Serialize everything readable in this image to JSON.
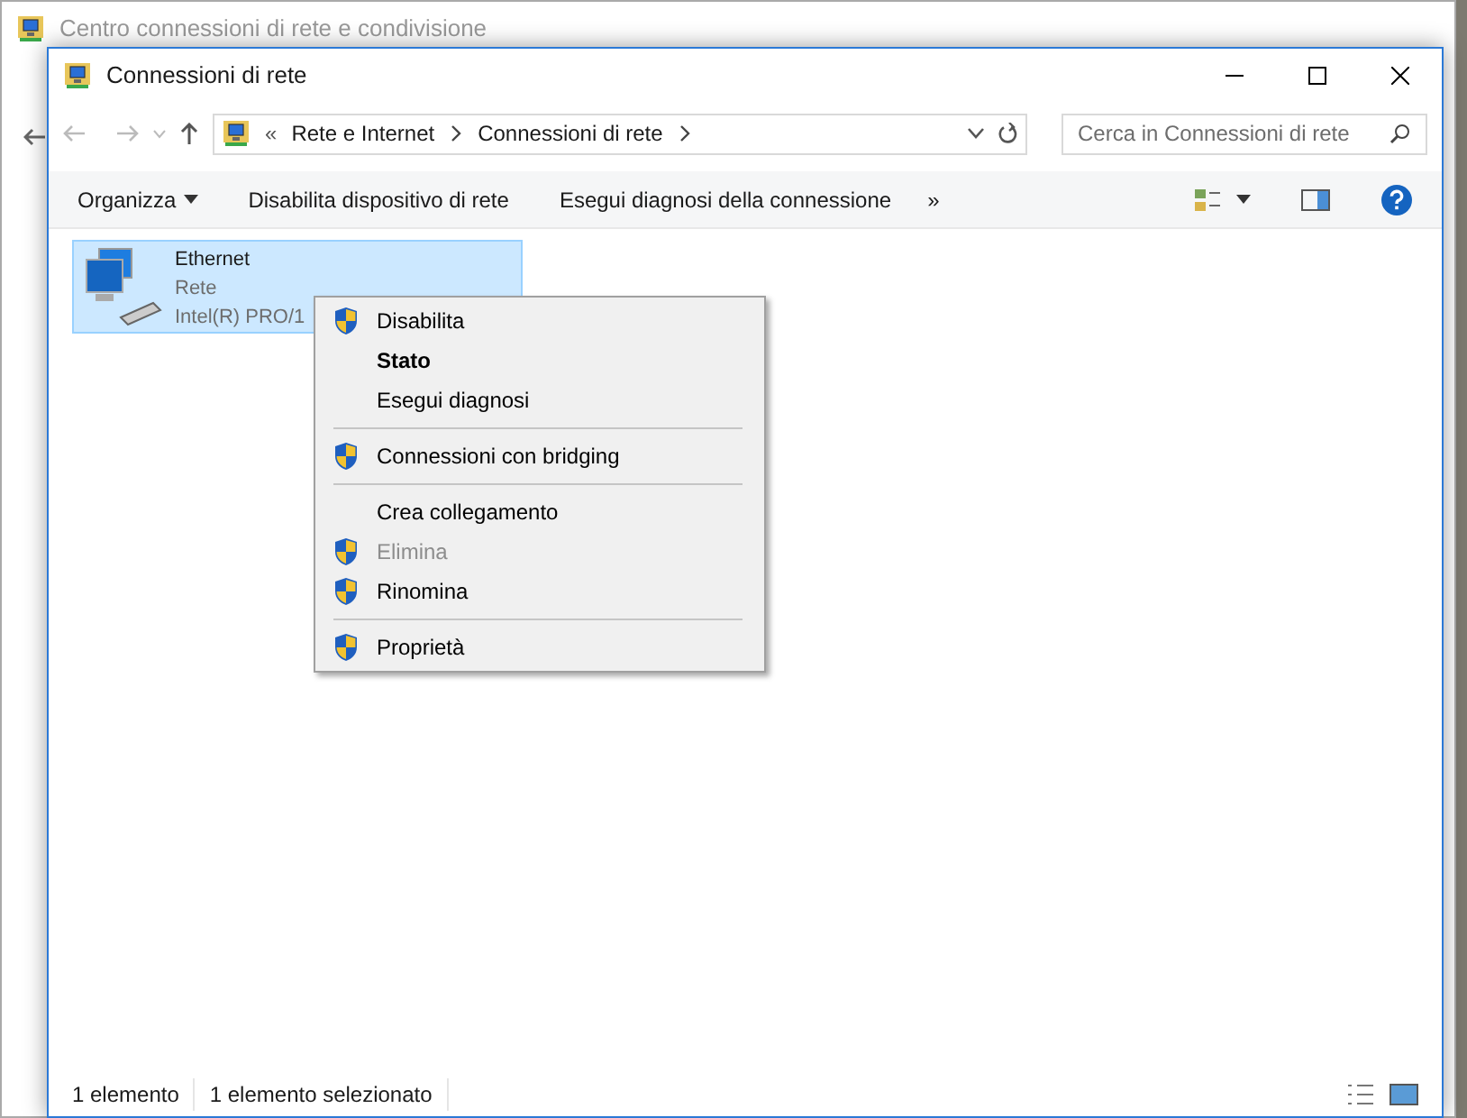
{
  "background_window": {
    "title": "Centro connessioni di rete e condivisione"
  },
  "window": {
    "title": "Connessioni di rete"
  },
  "address_bar": {
    "overflow": "«",
    "crumbs": [
      "Rete e Internet",
      "Connessioni di rete"
    ]
  },
  "search": {
    "placeholder": "Cerca in Connessioni di rete"
  },
  "toolbar": {
    "organize": "Organizza",
    "buttons": [
      "Disabilita dispositivo di rete",
      "Esegui diagnosi della connessione"
    ],
    "more": "»"
  },
  "items": [
    {
      "name": "Ethernet",
      "status": "Rete",
      "device": "Intel(R) PRO/1",
      "selected": true
    }
  ],
  "context_menu": [
    {
      "kind": "item",
      "label": "Disabilita",
      "shield": true,
      "bold": false,
      "disabled": false
    },
    {
      "kind": "item",
      "label": "Stato",
      "shield": false,
      "bold": true,
      "disabled": false
    },
    {
      "kind": "item",
      "label": "Esegui diagnosi",
      "shield": false,
      "bold": false,
      "disabled": false
    },
    {
      "kind": "separator"
    },
    {
      "kind": "item",
      "label": "Connessioni con bridging",
      "shield": true,
      "bold": false,
      "disabled": false
    },
    {
      "kind": "separator"
    },
    {
      "kind": "item",
      "label": "Crea collegamento",
      "shield": false,
      "bold": false,
      "disabled": false
    },
    {
      "kind": "item",
      "label": "Elimina",
      "shield": true,
      "bold": false,
      "disabled": true
    },
    {
      "kind": "item",
      "label": "Rinomina",
      "shield": true,
      "bold": false,
      "disabled": false
    },
    {
      "kind": "separator"
    },
    {
      "kind": "item",
      "label": "Proprietà",
      "shield": true,
      "bold": false,
      "disabled": false
    }
  ],
  "status_bar": [
    "1 elemento",
    "1 elemento selezionato"
  ]
}
